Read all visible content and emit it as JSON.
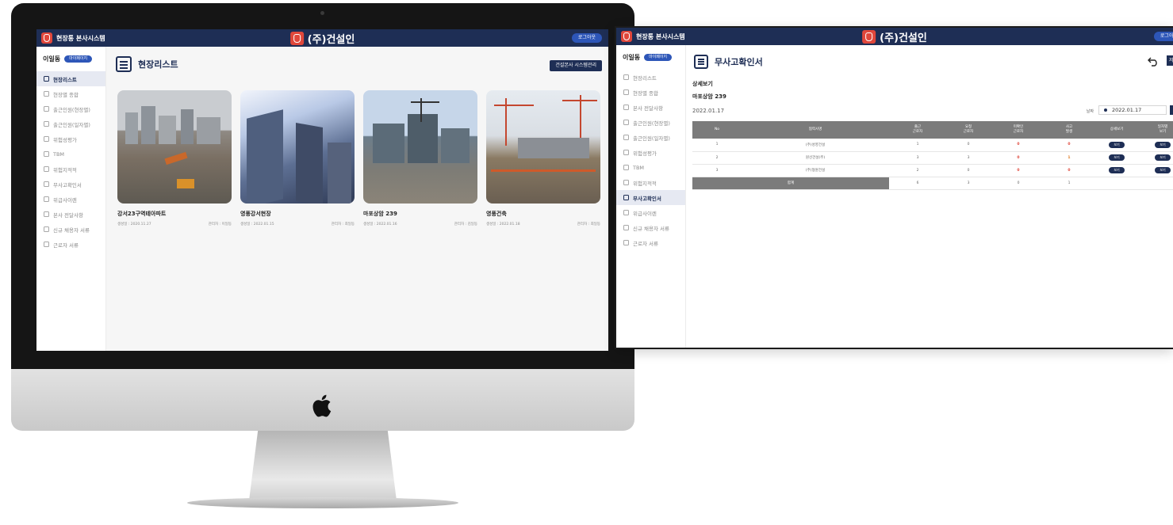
{
  "app": {
    "system_name": "현장통 본사시스템",
    "company": "(주)건설인",
    "logout_label": "로그아웃"
  },
  "user": {
    "name": "이일동",
    "mypage_label": "마이페이지"
  },
  "sidebar1": {
    "items": [
      {
        "label": "현장리스트"
      },
      {
        "label": "현장별 종합"
      },
      {
        "label": "출근인원(현장별)"
      },
      {
        "label": "출근인원(일자별)"
      },
      {
        "label": "위험성평가"
      },
      {
        "label": "TBM"
      },
      {
        "label": "위험지적적"
      },
      {
        "label": "무사고확인서"
      },
      {
        "label": "위급사이렌"
      },
      {
        "label": "본사 전달사항"
      },
      {
        "label": "신규 채용자 서류"
      },
      {
        "label": "근로자 서류"
      }
    ]
  },
  "screen1": {
    "page_title": "현장리스트",
    "sys_button": "건설본사 시스템관리",
    "sites": [
      {
        "name": "강서23구역테아파트",
        "created": "생성일 : 2020.11.27",
        "manager": "관리자 : 이일동"
      },
      {
        "name": "영풍강서현장",
        "created": "생성일 : 2022.01.15",
        "manager": "관리자 : 최일동"
      },
      {
        "name": "마포상암 239",
        "created": "생성일 : 2022.01.16",
        "manager": "관리자 : 김일동"
      },
      {
        "name": "영풍건축",
        "created": "생성일 : 2022.01.18",
        "manager": "관리자 : 최일동"
      }
    ]
  },
  "sidebar2": {
    "items": [
      {
        "label": "현장리스트"
      },
      {
        "label": "현장별 종합"
      },
      {
        "label": "본사 전달사항"
      },
      {
        "label": "출근인원(현장별)"
      },
      {
        "label": "출근인원(일자별)"
      },
      {
        "label": "위험성평가"
      },
      {
        "label": "TBM"
      },
      {
        "label": "위험지적적"
      },
      {
        "label": "무사고확인서"
      },
      {
        "label": "위급사이렌"
      },
      {
        "label": "신규 채용자 서류"
      },
      {
        "label": "근로자 서류"
      }
    ]
  },
  "screen2": {
    "page_title": "무사고확인서",
    "save_label": "저장",
    "section_title": "상세보기",
    "site_name": "마포상암 239",
    "current_date": "2022.01.17",
    "date_label": "날짜",
    "date_value": "2022.01.17",
    "table": {
      "headers": [
        "No",
        "협력사명",
        "출근\n근로자",
        "요청\n근로자",
        "미확인\n근로자",
        "사고\n발생",
        "상세보기",
        "일자별\n보기"
      ],
      "rows": [
        {
          "no": "1",
          "company": "(주)성영건설",
          "attend": "1",
          "request": "0",
          "unconfirmed": "0",
          "accident": "0",
          "view": "보기",
          "daily": "보기"
        },
        {
          "no": "2",
          "company": "원선건설(주)",
          "attend": "3",
          "request": "3",
          "unconfirmed": "0",
          "accident": "1",
          "view": "보기",
          "daily": "보기"
        },
        {
          "no": "3",
          "company": "(주)형원건설",
          "attend": "2",
          "request": "0",
          "unconfirmed": "0",
          "accident": "0",
          "view": "보기",
          "daily": "보기"
        }
      ],
      "total": {
        "label": "합계",
        "attend": "6",
        "request": "3",
        "unconfirmed": "0",
        "accident": "1"
      }
    }
  },
  "colors": {
    "header_navy": "#1e2e55",
    "accent_blue": "#2d56b8",
    "brand_red": "#e0473b",
    "table_header_gray": "#7b7b7b"
  }
}
